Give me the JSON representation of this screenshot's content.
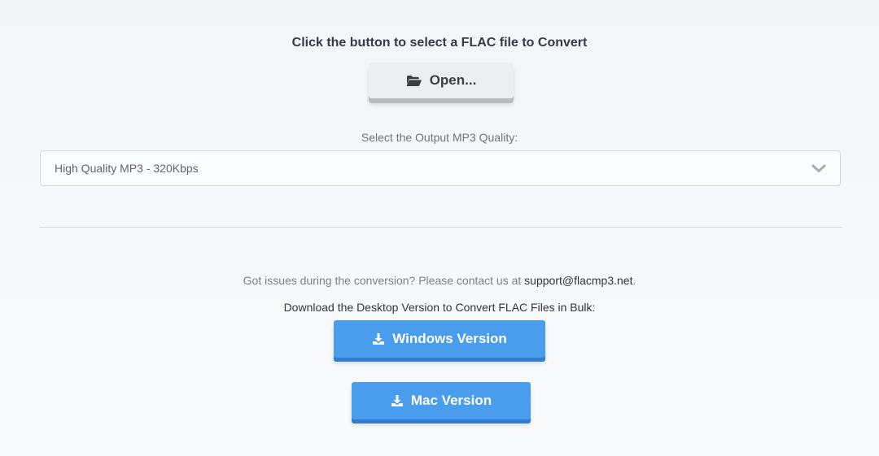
{
  "converter": {
    "heading": "Click the button to select a FLAC file to Convert",
    "open_button_label": "Open...",
    "open_icon": "folder-open-icon"
  },
  "quality": {
    "label": "Select the Output MP3 Quality:",
    "selected": "High Quality MP3 - 320Kbps",
    "dropdown_icon": "chevron-down-icon"
  },
  "support": {
    "text": "Got issues during the conversion? Please contact us at",
    "email": "support@flacmp3.net",
    "trailing": "."
  },
  "desktop": {
    "text": "Download the Desktop Version to Convert FLAC Files in Bulk:",
    "windows_label": "Windows Version",
    "mac_label": "Mac Version",
    "download_icon": "download-icon"
  },
  "colors": {
    "button_blue": "#4a9ced",
    "button_blue_shadow": "#2f7fd1",
    "open_button_bg": "#eceef0"
  }
}
